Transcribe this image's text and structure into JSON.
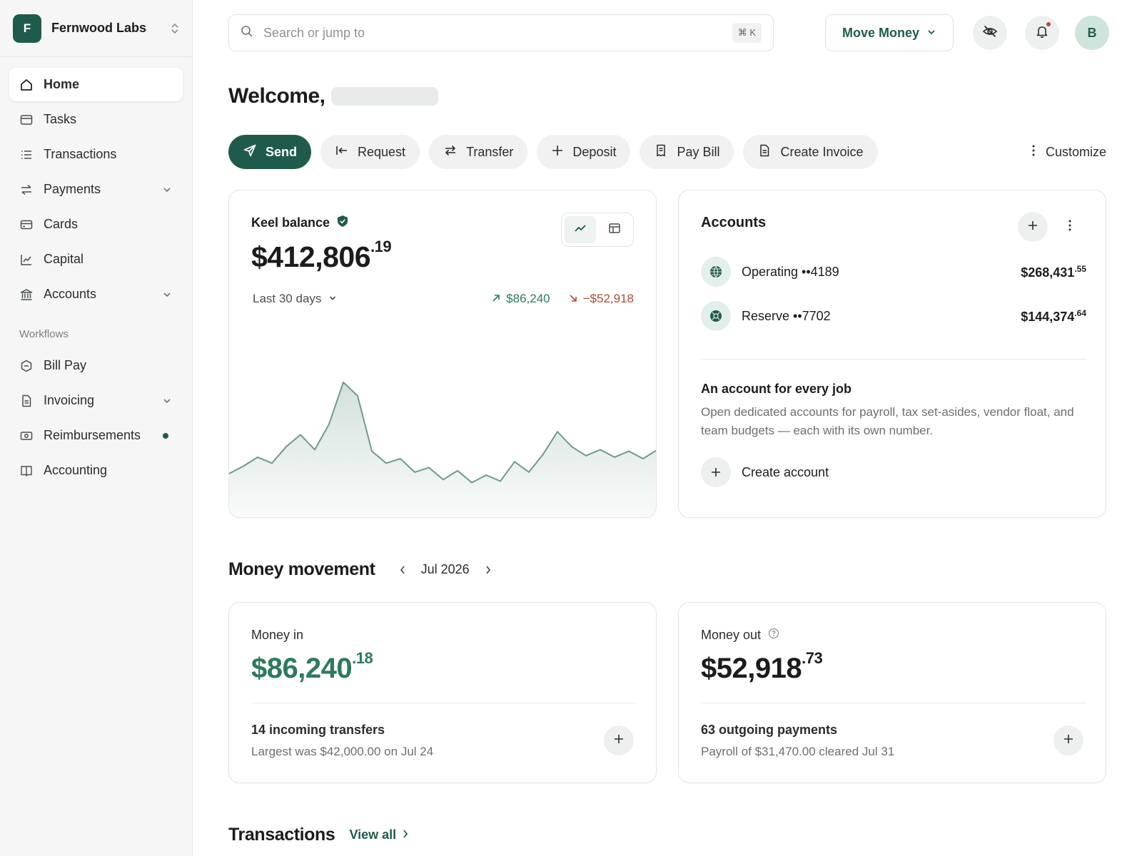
{
  "org": {
    "initial": "F",
    "name": "Fernwood Labs"
  },
  "nav": {
    "items": [
      {
        "label": "Home",
        "icon": "home-icon",
        "active": true
      },
      {
        "label": "Tasks",
        "icon": "tasks-icon"
      },
      {
        "label": "Transactions",
        "icon": "list-icon"
      },
      {
        "label": "Payments",
        "icon": "arrows-icon",
        "expandable": true
      },
      {
        "label": "Cards",
        "icon": "card-icon"
      },
      {
        "label": "Capital",
        "icon": "chart-icon"
      },
      {
        "label": "Accounts",
        "icon": "bank-icon",
        "expandable": true
      }
    ],
    "workflows_label": "Workflows",
    "workflows": [
      {
        "label": "Bill Pay",
        "icon": "bill-icon"
      },
      {
        "label": "Invoicing",
        "icon": "invoice-icon",
        "expandable": true
      },
      {
        "label": "Reimbursements",
        "icon": "cash-icon",
        "has_dot": true
      },
      {
        "label": "Accounting",
        "icon": "book-icon"
      }
    ]
  },
  "search": {
    "placeholder": "Search or jump to",
    "shortcut": "⌘ K"
  },
  "topbar": {
    "move_money": "Move Money",
    "avatar_initial": "B"
  },
  "welcome": {
    "text": "Welcome,"
  },
  "actions": {
    "send": "Send",
    "request": "Request",
    "transfer": "Transfer",
    "deposit": "Deposit",
    "pay_bill": "Pay Bill",
    "create_invoice": "Create Invoice",
    "customize": "Customize"
  },
  "balance": {
    "title": "Keel balance",
    "amount_main": "$412,806",
    "amount_cents": ".19",
    "range": "Last 30 days",
    "delta_in": "$86,240",
    "delta_out": "−$52,918"
  },
  "chart_data": {
    "type": "area",
    "title": "",
    "xlabel": "",
    "ylabel": "",
    "ylim": [
      0,
      100
    ],
    "grid": false,
    "values": [
      30,
      35,
      41,
      37,
      48,
      56,
      46,
      63,
      91,
      82,
      45,
      37,
      40,
      31,
      34,
      26,
      32,
      24,
      29,
      25,
      38,
      31,
      43,
      58,
      48,
      42,
      46,
      41,
      45,
      40,
      46
    ]
  },
  "accounts": {
    "title": "Accounts",
    "list": [
      {
        "name": "Operating ••4189",
        "balance_main": "$268,431",
        "balance_cents": ".55"
      },
      {
        "name": "Reserve ••7702",
        "balance_main": "$144,374",
        "balance_cents": ".64"
      }
    ],
    "promo_title": "An account for every job",
    "promo_text": "Open dedicated accounts for payroll, tax set-asides, vendor float, and team budgets — each with its own number.",
    "create_label": "Create account"
  },
  "money_movement": {
    "title": "Money movement",
    "month": "Jul 2026",
    "in": {
      "label": "Money in",
      "amount_main": "$86,240",
      "amount_cents": ".18",
      "summary": "14 incoming transfers",
      "detail": "Largest was $42,000.00 on Jul 24"
    },
    "out": {
      "label": "Money out",
      "amount_main": "$52,918",
      "amount_cents": ".73",
      "summary": "63 outgoing payments",
      "detail": "Payroll of $31,470.00 cleared Jul 31"
    }
  },
  "transactions": {
    "title": "Transactions",
    "view_all": "View all"
  },
  "colors": {
    "brand": "#1f5b4d",
    "positive": "#2d7a5c",
    "negative": "#b24a3a",
    "notification": "#c24141"
  }
}
